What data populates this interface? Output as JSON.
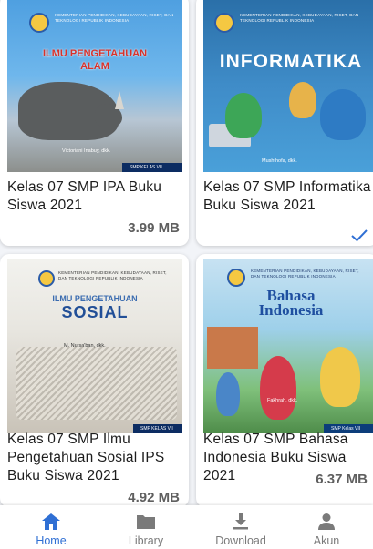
{
  "books": [
    {
      "title": "Kelas 07 SMP IPA Buku Siswa 2021",
      "size": "3.99 MB",
      "cover": {
        "heading": "ILMU PENGETAHUAN ALAM",
        "publisher": "KEMENTERIAN PENDIDIKAN, KEBUDAYAAN, RISET, DAN TEKNOLOGI REPUBLIK INDONESIA",
        "author": "Victoriani Inabuy, dkk.",
        "band": "SMP KELAS VII"
      }
    },
    {
      "title": "Kelas 07 SMP Informatika Buku Siswa 2021",
      "size": "",
      "downloaded": true,
      "cover": {
        "heading": "INFORMATIKA",
        "publisher": "KEMENTERIAN PENDIDIKAN, KEBUDAYAAN, RISET, DAN TEKNOLOGI REPUBLIK INDONESIA",
        "author": "Mushthofa, dkk.",
        "band": ""
      }
    },
    {
      "title": "Kelas 07 SMP Ilmu Pengetahuan Sosial IPS Buku Siswa 2021",
      "size": "4.92 MB",
      "cover": {
        "heading_top": "ILMU PENGETAHUAN",
        "heading": "SOSIAL",
        "publisher": "KEMENTERIAN PENDIDIKAN, KEBUDAYAAN, RISET, DAN TEKNOLOGI REPUBLIK INDONESIA",
        "author": "M. Nursa'ban, dkk.",
        "band": "SMP KELAS VII"
      }
    },
    {
      "title": "Kelas 07 SMP Bahasa Indonesia Buku Siswa 2021",
      "size": "6.37 MB",
      "cover": {
        "heading_top": "Bahasa",
        "heading": "Indonesia",
        "publisher": "KEMENTERIAN PENDIDIKAN, KEBUDAYAAN, RISET, DAN TEKNOLOGI REPUBLIK INDONESIA",
        "author": "Fakhrah, dkk.",
        "band": "SMP Kelas VII"
      }
    }
  ],
  "nav": {
    "items": [
      {
        "label": "Home",
        "icon": "home-icon",
        "active": true
      },
      {
        "label": "Library",
        "icon": "folder-icon",
        "active": false
      },
      {
        "label": "Download",
        "icon": "download-icon",
        "active": false
      },
      {
        "label": "Akun",
        "icon": "person-icon",
        "active": false
      }
    ]
  },
  "colors": {
    "accent": "#2f6fd4",
    "inactive": "#7a7a7a",
    "band": "#0c2c62"
  }
}
